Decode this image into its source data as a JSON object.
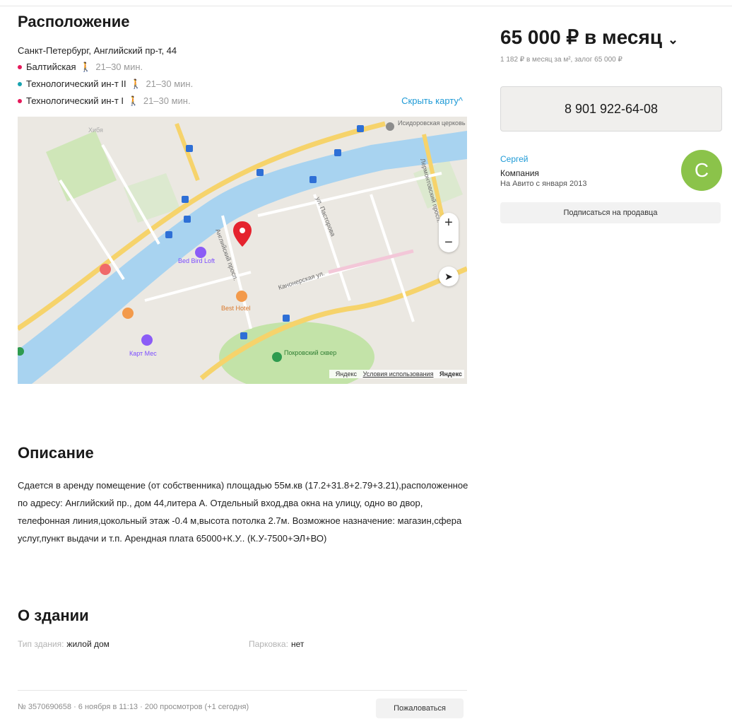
{
  "location": {
    "title": "Расположение",
    "address": "Санкт-Петербург, Английский пр-т, 44",
    "hide_map_label": "Скрыть карту^",
    "metro": [
      {
        "name": "Балтийская",
        "time": "21–30 мин.",
        "color": "#e5195a"
      },
      {
        "name": "Технологический ин-т II",
        "time": "21–30 мин.",
        "color": "#18a3b0"
      },
      {
        "name": "Технологический ин-т I",
        "time": "21–30 мин.",
        "color": "#e5195a"
      }
    ],
    "map": {
      "places": [
        "Исидоровская церковь",
        "Хибя",
        "Bed Bird Loft",
        "Best Hotel",
        "Покровский сквер",
        "Карт Мес"
      ],
      "streets": [
        "Английский просп.",
        "Канонерская ул.",
        "ул. Пасторова",
        "Лермонтовский просп."
      ],
      "footer_provider": "Яндекс",
      "footer_terms": "Условия использования",
      "footer_logo": "Яндекс",
      "zoom_in": "+",
      "zoom_out": "−",
      "locate": "➤"
    }
  },
  "description": {
    "title": "Описание",
    "text": "Сдается в аренду помещение (от собственника) площадью 55м.кв (17.2+31.8+2.79+3.21),расположенное по адресу: Английский пр., дом 44,литера А. Отдельный вход,два окна на улицу, одно во двор, телефонная линия,цокольный этаж -0.4 м,высота потолка 2.7м. Возможное назначение: магазин,сфера услуг,пункт выдачи и т.п. Арендная плата 65000+К.У.. (К.У-7500+ЭЛ+ВО)"
  },
  "building": {
    "title": "О здании",
    "type_label": "Тип здания:",
    "type_value": "жилой дом",
    "parking_label": "Парковка:",
    "parking_value": "нет"
  },
  "footer": {
    "meta": "№ 3570690658 · 6 ноября в 11:13 · 200 просмотров (+1 сегодня)",
    "complain_label": "Пожаловаться"
  },
  "sidebar": {
    "price": "65 000 ₽ в месяц",
    "price_sub": "1 182 ₽ в месяц за м², залог 65 000 ₽",
    "phone": "8 901 922-64-08",
    "seller_name": "Сергей",
    "seller_type": "Компания",
    "seller_since": "На Авито с января 2013",
    "avatar_letter": "С",
    "avatar_color": "#8bc34a",
    "subscribe_label": "Подписаться на продавца"
  }
}
